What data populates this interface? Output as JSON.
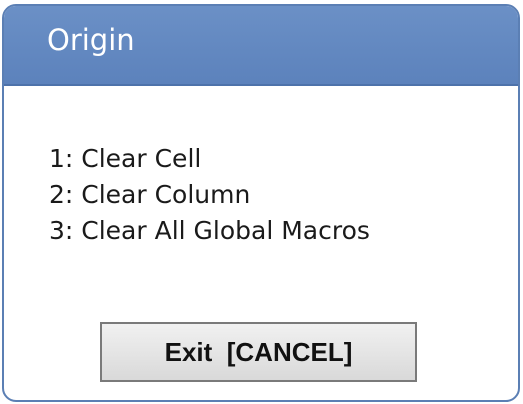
{
  "dialog": {
    "title": "Origin",
    "options": [
      {
        "label": "1: Clear Cell"
      },
      {
        "label": "2: Clear Column"
      },
      {
        "label": "3: Clear All Global Macros"
      }
    ],
    "exit_button_label": "Exit  [CANCEL]"
  },
  "colors": {
    "title_bar": "#5c82bc",
    "title_text": "#ffffff",
    "border": "#5b7fb4",
    "button_face": "#e4e4e4"
  }
}
